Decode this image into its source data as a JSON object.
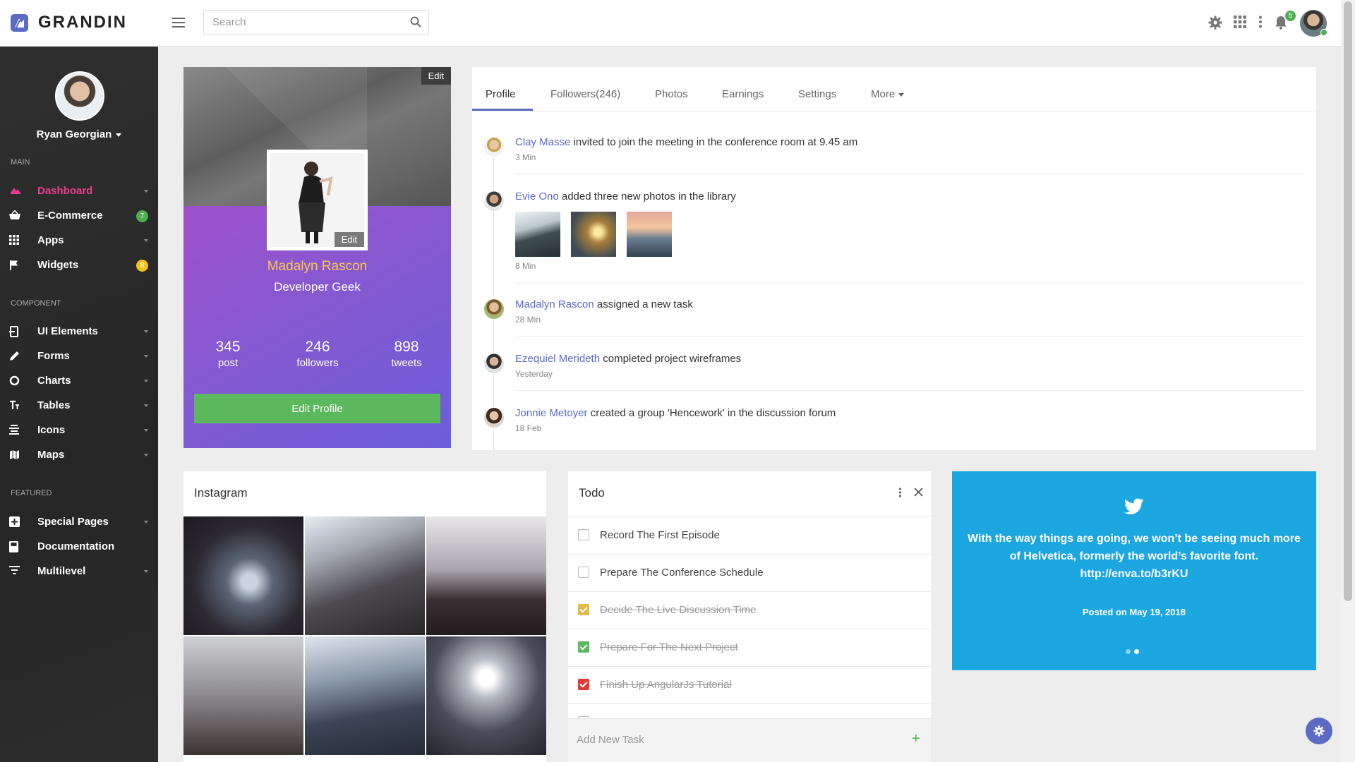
{
  "app": {
    "name": "GRANDIN",
    "accent": "#5c6ac4"
  },
  "search": {
    "placeholder": "Search"
  },
  "topbar": {
    "notifications_count": "5",
    "icons": [
      "gear-icon",
      "apps-grid-icon",
      "more-vertical-icon",
      "bell-icon"
    ]
  },
  "sidebar": {
    "user_name": "Ryan Georgian",
    "sections": {
      "main": "MAIN",
      "component": "COMPONENT",
      "featured": "FEATURED"
    },
    "main_items": [
      {
        "label": "Dashboard",
        "icon": "dashboard-icon",
        "active": true
      },
      {
        "label": "E-Commerce",
        "icon": "basket-icon",
        "badge": "7",
        "badge_color": "#4caf50"
      },
      {
        "label": "Apps",
        "icon": "apps-grid-icon"
      },
      {
        "label": "Widgets",
        "icon": "flag-icon",
        "badge": "8",
        "badge_color": "#f0c419"
      }
    ],
    "component_items": [
      {
        "label": "UI Elements",
        "icon": "ui-elements-icon"
      },
      {
        "label": "Forms",
        "icon": "pencil-icon"
      },
      {
        "label": "Charts",
        "icon": "chart-ring-icon"
      },
      {
        "label": "Tables",
        "icon": "table-icon"
      },
      {
        "label": "Icons",
        "icon": "icons-icon"
      },
      {
        "label": "Maps",
        "icon": "map-icon"
      }
    ],
    "featured_items": [
      {
        "label": "Special Pages",
        "icon": "special-pages-icon"
      },
      {
        "label": "Documentation",
        "icon": "book-icon"
      },
      {
        "label": "Multilevel",
        "icon": "filter-icon"
      }
    ]
  },
  "profile": {
    "cover_edit": "Edit",
    "photo_edit": "Edit",
    "name": "Madalyn Rascon",
    "role": "Developer Geek",
    "stats": [
      {
        "value": "345",
        "label": "post"
      },
      {
        "value": "246",
        "label": "followers"
      },
      {
        "value": "898",
        "label": "tweets"
      }
    ],
    "edit_button": "Edit Profile"
  },
  "tabs": [
    "Profile",
    "Followers(246)",
    "Photos",
    "Earnings",
    "Settings",
    "More"
  ],
  "activity": [
    {
      "name": "Clay Masse",
      "text": "invited to join the meeting in the conference room at 9.45 am",
      "time": "3 Min"
    },
    {
      "name": "Evie Ono",
      "text": "added three new photos in the library",
      "time": "8 Min"
    },
    {
      "name": "Madalyn Rascon",
      "text": "assigned a new task",
      "time": "28 Min"
    },
    {
      "name": "Ezequiel Merideth",
      "text": "completed project wireframes",
      "time": "Yesterday"
    },
    {
      "name": "Jonnie Metoyer",
      "text": "created a group 'Hencework' in the discussion forum",
      "time": "18 Feb"
    }
  ],
  "instagram": {
    "title": "Instagram"
  },
  "todo": {
    "title": "Todo",
    "items": [
      {
        "label": "Record The First Episode",
        "done": false
      },
      {
        "label": "Prepare The Conference Schedule",
        "done": false
      },
      {
        "label": "Decide The Live Discussion Time",
        "done": true,
        "color": "#e5b94a"
      },
      {
        "label": "Prepare For The Next Project",
        "done": true,
        "color": "#5cb85c"
      },
      {
        "label": "Finish Up AngularJs Tutorial",
        "done": true,
        "color": "#e53935"
      }
    ],
    "add_placeholder": "Add New Task"
  },
  "tweet": {
    "text": "With the way things are going, we won’t be seeing much more of Helvetica, formerly the world’s favorite font. http://enva.to/b3rKU",
    "date": "Posted on May 19, 2018",
    "color": "#1da7e0"
  }
}
